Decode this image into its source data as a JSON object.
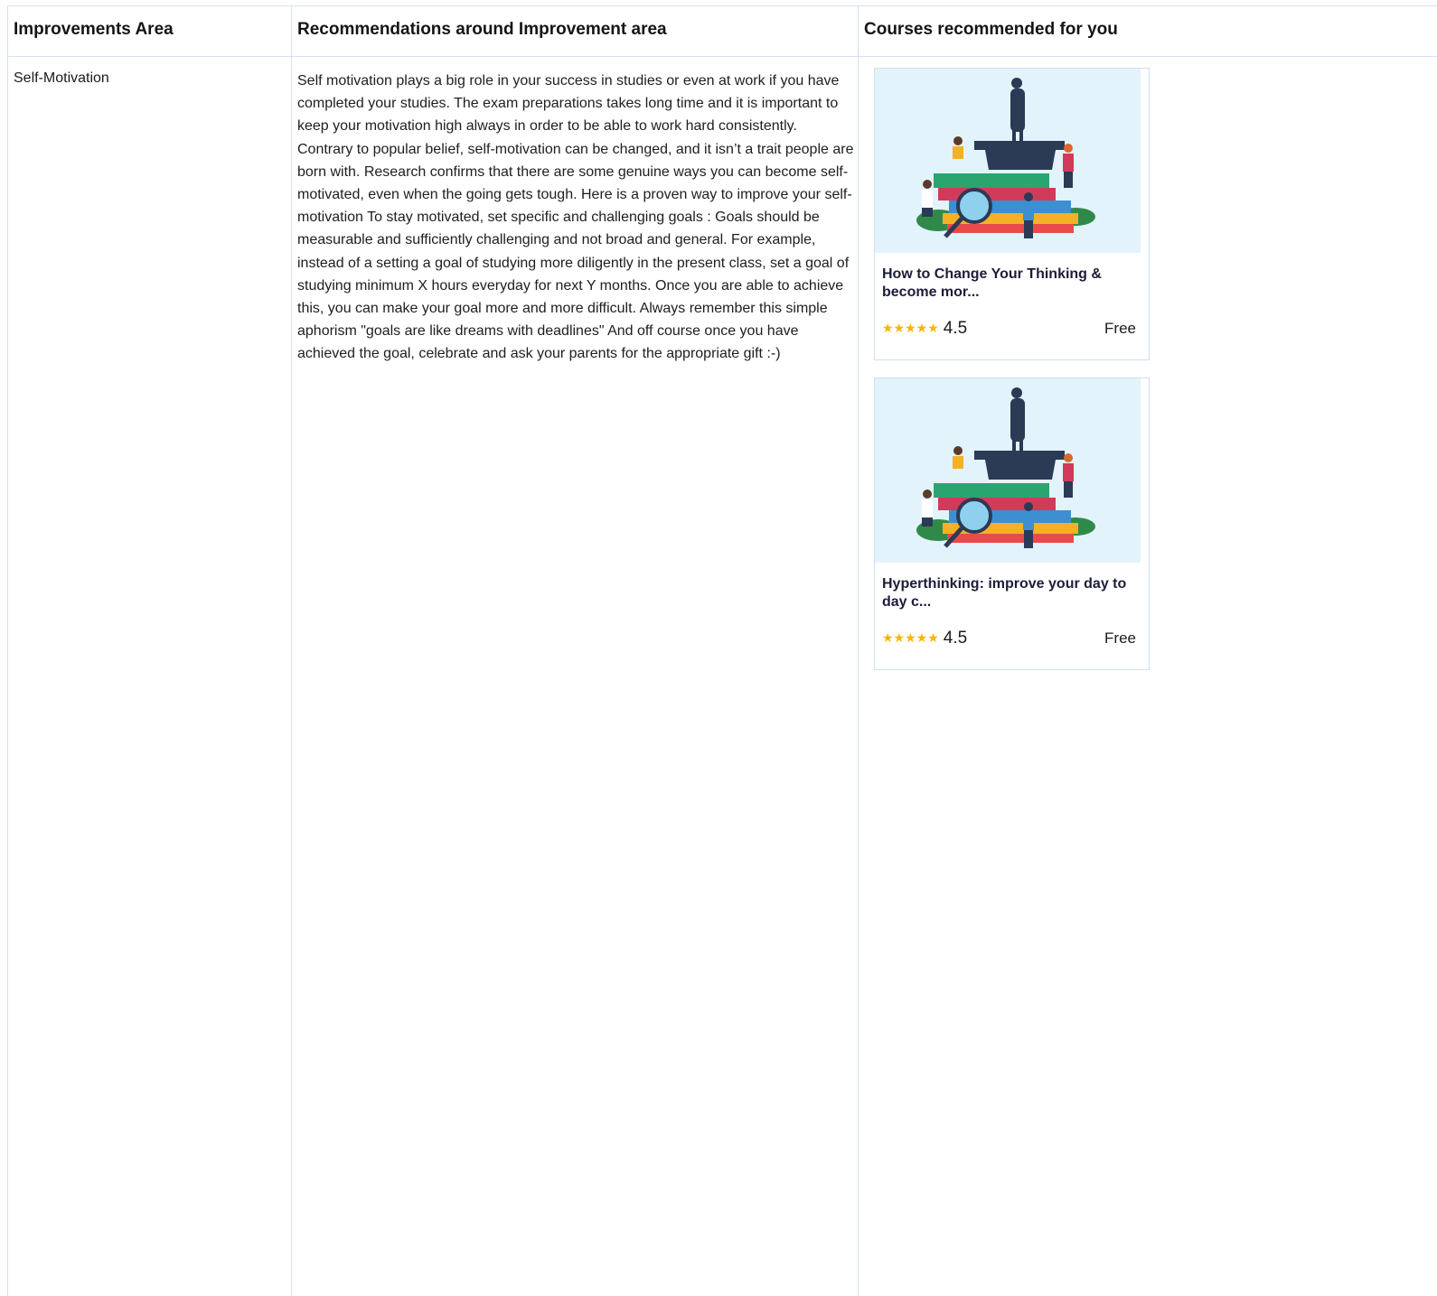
{
  "table": {
    "headers": {
      "area": "Improvements Area",
      "recommendations": "Recommendations around Improvement area",
      "courses": "Courses recommended for you"
    },
    "rows": [
      {
        "area": "Self-Motivation",
        "recommendation": "Self motivation plays a big role in your success in studies or even at work if you have completed your studies. The exam preparations takes long time and it is important to keep your motivation high always in order to be able to work hard consistently. Contrary to popular belief, self-motivation can be changed, and it isn’t a trait people are born with. Research confirms that there are some genuine ways you can become self-motivated, even when the going gets tough. Here is a proven way to improve your self-motivation To stay motivated, set specific and challenging goals : Goals should be measurable and sufficiently challenging and not broad and general. For example, instead of a setting a goal of studying more diligently in the present class, set a goal of studying minimum X hours everyday for next Y months. Once you are able to achieve this, you can make your goal more and more difficult. Always remember this simple aphorism \"goals are like dreams with deadlines\" And off course once you have achieved the goal, celebrate and ask your parents for the appropriate gift :-)",
        "courses": [
          {
            "title": "How to Change Your Thinking & become mor...",
            "stars": "★★★★★",
            "rating": "4.5",
            "price": "Free",
            "image_icon": "students-with-books-illustration"
          },
          {
            "title": "Hyperthinking: improve your day to day c...",
            "stars": "★★★★★",
            "rating": "4.5",
            "price": "Free",
            "image_icon": "students-with-books-illustration"
          }
        ]
      }
    ]
  },
  "colors": {
    "border": "#d6e1f1",
    "star": "#f7b500",
    "course_title": "#1c1d3a",
    "image_bg": "#e3f3fb"
  }
}
